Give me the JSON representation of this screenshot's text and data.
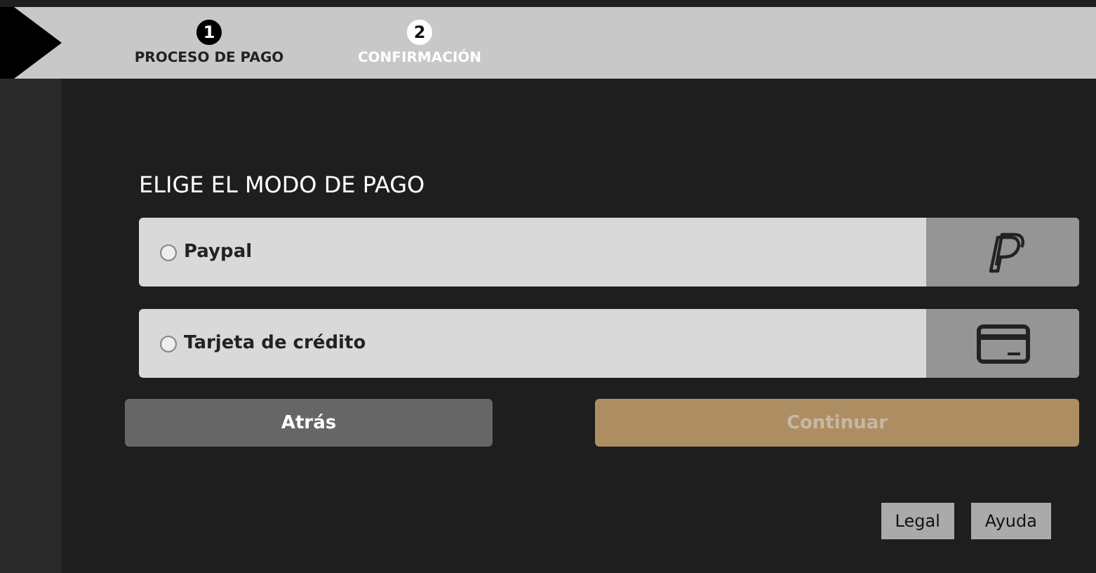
{
  "steps": [
    {
      "number": "1",
      "label": "PROCESO DE PAGO",
      "selected": true
    },
    {
      "number": "2",
      "label": "CONFIRMACIÓN",
      "selected": false
    }
  ],
  "heading": "ELIGE EL MODO DE PAGO",
  "payment_options": [
    {
      "label": "Paypal",
      "kind": "paypal",
      "checked": false
    },
    {
      "label": "Tarjeta de crédito",
      "kind": "card",
      "checked": false
    }
  ],
  "buttons": [
    {
      "label": "Atrás",
      "kind": "back",
      "disabled": false
    },
    {
      "label": "Continuar",
      "kind": "continue",
      "disabled": true
    }
  ],
  "footer_links": [
    "Legal",
    "Ayuda"
  ]
}
